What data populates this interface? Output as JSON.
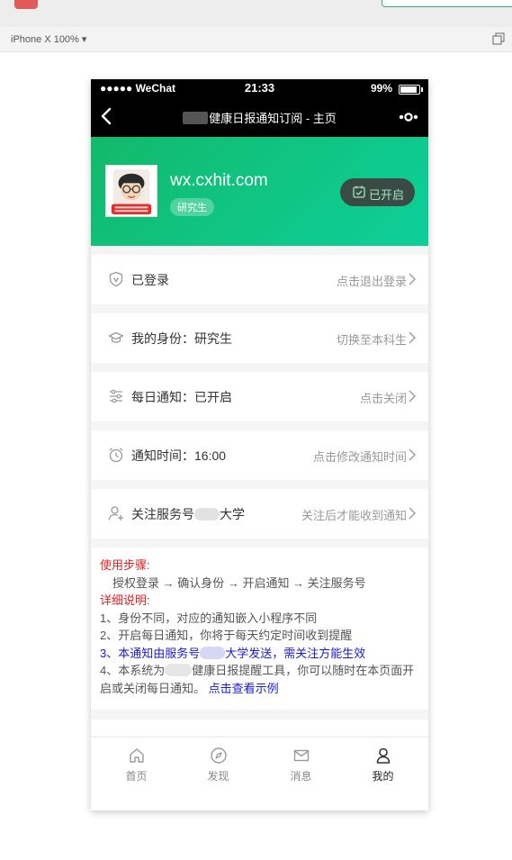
{
  "device": {
    "label": "iPhone X 100% ▾"
  },
  "status": {
    "carrier": "●●●●● WeChat",
    "time": "21:33",
    "battery": "99%",
    "battery_level": 0.99
  },
  "nav": {
    "title": "健康日报通知订阅 - 主页"
  },
  "profile": {
    "domain": "wx.cxhit.com",
    "role": "研究生",
    "open_status": "已开启"
  },
  "rows": [
    {
      "label": "已登录",
      "action": "点击退出登录",
      "icon": "shield-icon"
    },
    {
      "label": "我的身份：研究生",
      "action": "切换至本科生",
      "icon": "graduation-cap-icon"
    },
    {
      "label": "每日通知：已开启",
      "action": "点击关闭",
      "icon": "sliders-icon"
    },
    {
      "label": "通知时间：16:00",
      "action": "点击修改通知时间",
      "icon": "alarm-clock-icon"
    },
    {
      "label_prefix": "关注服务号",
      "label_suffix": "大学",
      "action": "关注后才能收到通知",
      "icon": "user-add-icon"
    }
  ],
  "instructions": {
    "steps_title": "使用步骤:",
    "steps": "授权登录 → 确认身份 → 开启通知 → 关注服务号",
    "detail_title": "详细说明:",
    "line1": "1、身份不同，对应的通知嵌入小程序不同",
    "line2": "2、开启每日通知，你将于每天约定时间收到提醒",
    "line3_prefix": "3、本通知由服务号",
    "line3_suffix": "大学发送，需关注方能生效",
    "line4_prefix": "4、本系统为",
    "line4_suffix": "健康日报提醒工具，你可以随时在本页面开启或关闭每日通知。",
    "example_link": "点击查看示例"
  },
  "tabs": [
    {
      "label": "首页",
      "icon": "home-icon",
      "active": false
    },
    {
      "label": "发现",
      "icon": "compass-icon",
      "active": false
    },
    {
      "label": "消息",
      "icon": "mail-icon",
      "active": false
    },
    {
      "label": "我的",
      "icon": "user-icon",
      "active": true
    }
  ],
  "colors": {
    "accent": "#12b96b",
    "link": "#1a1ad2",
    "warning": "#e02020"
  }
}
